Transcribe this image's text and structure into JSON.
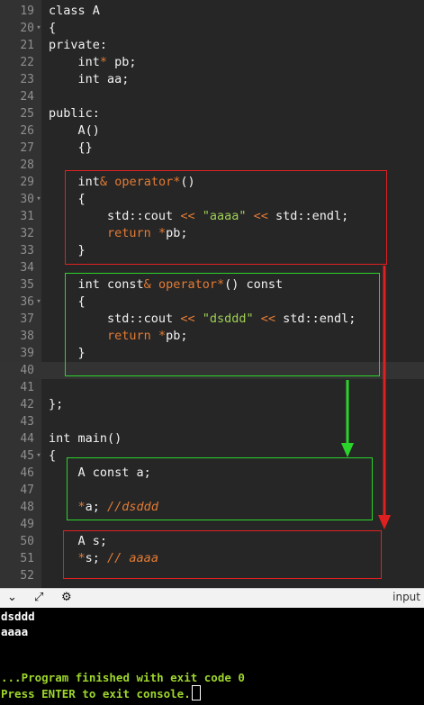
{
  "editor": {
    "lines": [
      {
        "num": "19",
        "fold": "",
        "segs": [
          {
            "t": "class A",
            "c": ""
          }
        ]
      },
      {
        "num": "20",
        "fold": "▾",
        "segs": [
          {
            "t": "{",
            "c": ""
          }
        ]
      },
      {
        "num": "21",
        "fold": "",
        "segs": [
          {
            "t": "private:",
            "c": ""
          }
        ]
      },
      {
        "num": "22",
        "fold": "",
        "segs": [
          {
            "t": "    int",
            "c": ""
          },
          {
            "t": "*",
            "c": "op"
          },
          {
            "t": " pb;",
            "c": ""
          }
        ]
      },
      {
        "num": "23",
        "fold": "",
        "segs": [
          {
            "t": "    int aa;",
            "c": ""
          }
        ]
      },
      {
        "num": "24",
        "fold": "",
        "segs": []
      },
      {
        "num": "25",
        "fold": "",
        "segs": [
          {
            "t": "public:",
            "c": ""
          }
        ]
      },
      {
        "num": "26",
        "fold": "",
        "segs": [
          {
            "t": "    A()",
            "c": ""
          }
        ]
      },
      {
        "num": "27",
        "fold": "",
        "segs": [
          {
            "t": "    {}",
            "c": ""
          }
        ]
      },
      {
        "num": "28",
        "fold": "",
        "segs": []
      },
      {
        "num": "29",
        "fold": "",
        "segs": [
          {
            "t": "    int",
            "c": ""
          },
          {
            "t": "&",
            "c": "op"
          },
          {
            "t": " ",
            "c": ""
          },
          {
            "t": "operator*",
            "c": "op"
          },
          {
            "t": "()",
            "c": ""
          }
        ]
      },
      {
        "num": "30",
        "fold": "▾",
        "segs": [
          {
            "t": "    {",
            "c": ""
          }
        ]
      },
      {
        "num": "31",
        "fold": "",
        "segs": [
          {
            "t": "        std::cout ",
            "c": ""
          },
          {
            "t": "<<",
            "c": "op"
          },
          {
            "t": " ",
            "c": ""
          },
          {
            "t": "\"aaaa\"",
            "c": "str"
          },
          {
            "t": " ",
            "c": ""
          },
          {
            "t": "<<",
            "c": "op"
          },
          {
            "t": " std::endl;",
            "c": ""
          }
        ]
      },
      {
        "num": "32",
        "fold": "",
        "segs": [
          {
            "t": "        ",
            "c": ""
          },
          {
            "t": "return",
            "c": "op"
          },
          {
            "t": " ",
            "c": ""
          },
          {
            "t": "*",
            "c": "op"
          },
          {
            "t": "pb;",
            "c": ""
          }
        ]
      },
      {
        "num": "33",
        "fold": "",
        "segs": [
          {
            "t": "    }",
            "c": ""
          }
        ]
      },
      {
        "num": "34",
        "fold": "",
        "segs": []
      },
      {
        "num": "35",
        "fold": "",
        "segs": [
          {
            "t": "    int const",
            "c": ""
          },
          {
            "t": "&",
            "c": "op"
          },
          {
            "t": " ",
            "c": ""
          },
          {
            "t": "operator*",
            "c": "op"
          },
          {
            "t": "() const",
            "c": ""
          }
        ]
      },
      {
        "num": "36",
        "fold": "▾",
        "segs": [
          {
            "t": "    {",
            "c": ""
          }
        ]
      },
      {
        "num": "37",
        "fold": "",
        "segs": [
          {
            "t": "        std::cout ",
            "c": ""
          },
          {
            "t": "<<",
            "c": "op"
          },
          {
            "t": " ",
            "c": ""
          },
          {
            "t": "\"dsddd\"",
            "c": "str"
          },
          {
            "t": " ",
            "c": ""
          },
          {
            "t": "<<",
            "c": "op"
          },
          {
            "t": " std::endl;",
            "c": ""
          }
        ]
      },
      {
        "num": "38",
        "fold": "",
        "segs": [
          {
            "t": "        ",
            "c": ""
          },
          {
            "t": "return",
            "c": "op"
          },
          {
            "t": " ",
            "c": ""
          },
          {
            "t": "*",
            "c": "op"
          },
          {
            "t": "pb;",
            "c": ""
          }
        ]
      },
      {
        "num": "39",
        "fold": "",
        "segs": [
          {
            "t": "    }",
            "c": ""
          }
        ]
      },
      {
        "num": "40",
        "fold": "",
        "segs": [],
        "active": true
      },
      {
        "num": "41",
        "fold": "",
        "segs": []
      },
      {
        "num": "42",
        "fold": "",
        "segs": [
          {
            "t": "};",
            "c": ""
          }
        ]
      },
      {
        "num": "43",
        "fold": "",
        "segs": []
      },
      {
        "num": "44",
        "fold": "",
        "segs": [
          {
            "t": "int main()",
            "c": ""
          }
        ]
      },
      {
        "num": "45",
        "fold": "▾",
        "segs": [
          {
            "t": "{",
            "c": ""
          }
        ]
      },
      {
        "num": "46",
        "fold": "",
        "segs": [
          {
            "t": "    A const a;",
            "c": ""
          }
        ]
      },
      {
        "num": "47",
        "fold": "",
        "segs": []
      },
      {
        "num": "48",
        "fold": "",
        "segs": [
          {
            "t": "    ",
            "c": ""
          },
          {
            "t": "*",
            "c": "op"
          },
          {
            "t": "a; ",
            "c": ""
          },
          {
            "t": "//dsddd",
            "c": "cm"
          }
        ]
      },
      {
        "num": "49",
        "fold": "",
        "segs": []
      },
      {
        "num": "50",
        "fold": "",
        "segs": [
          {
            "t": "    A s;",
            "c": ""
          }
        ]
      },
      {
        "num": "51",
        "fold": "",
        "segs": [
          {
            "t": "    ",
            "c": ""
          },
          {
            "t": "*",
            "c": "op"
          },
          {
            "t": "s; ",
            "c": ""
          },
          {
            "t": "// aaaa",
            "c": "cm"
          }
        ]
      },
      {
        "num": "52",
        "fold": "",
        "segs": []
      }
    ]
  },
  "toolbar": {
    "input_label": "input",
    "icons": [
      "chevron-down-icon",
      "expand-icon",
      "settings-icon"
    ]
  },
  "console": {
    "lines": [
      {
        "text": "dsddd",
        "color": "#ffffff"
      },
      {
        "text": "aaaa",
        "color": "#ffffff"
      },
      {
        "text": "",
        "color": "#ffffff"
      },
      {
        "text": "",
        "color": "#ffffff"
      },
      {
        "text": "...Program finished with exit code 0",
        "color": "#9ed62c"
      },
      {
        "text": "Press ENTER to exit console.",
        "color": "#9ed62c"
      }
    ]
  },
  "annotations": {
    "red": "#e02020",
    "green": "#2ad42a"
  }
}
